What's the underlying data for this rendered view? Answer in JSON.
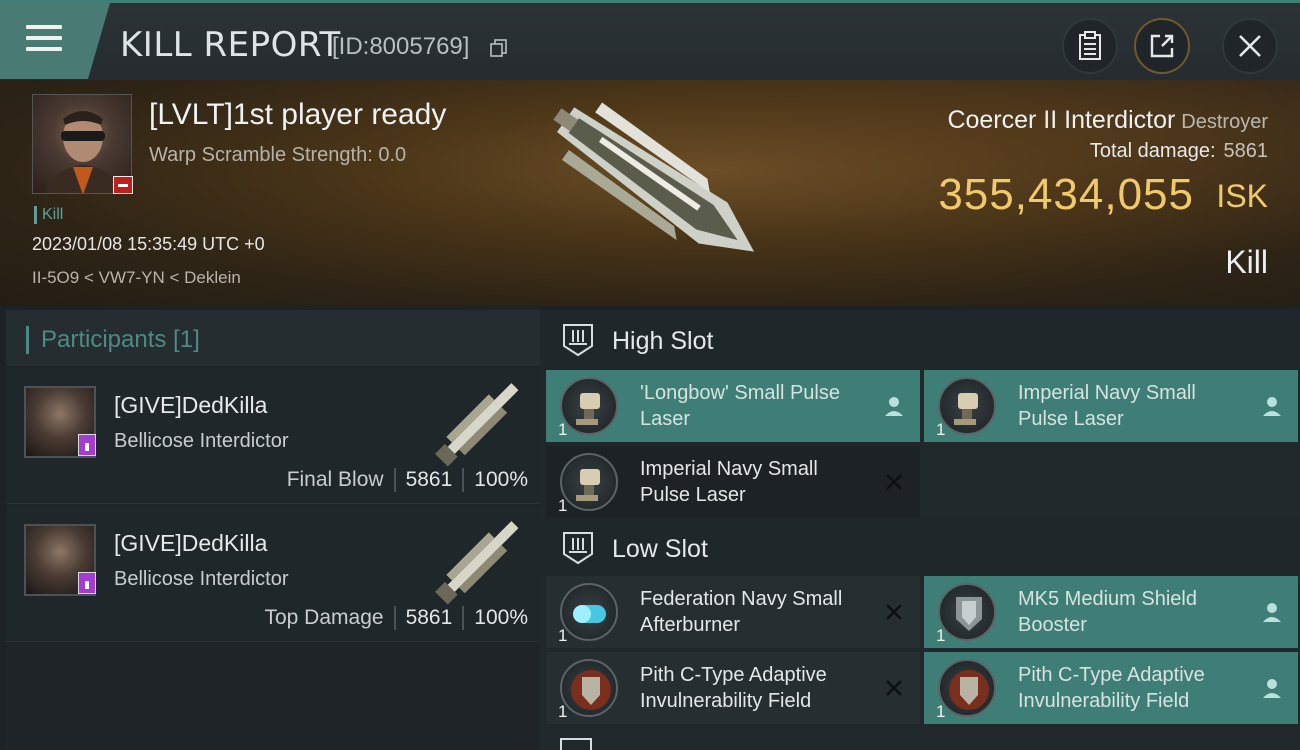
{
  "header": {
    "title": "KILL REPORT",
    "id_label": "[ID:8005769]"
  },
  "victim": {
    "name": "[LVLT]1st player ready",
    "warp": "Warp Scramble Strength: 0.0",
    "kill_tag": "Kill",
    "datetime": "2023/01/08 15:35:49 UTC +0",
    "location": "II-5O9 < VW7-YN < Deklein",
    "ship_name": "Coercer II Interdictor",
    "ship_class": "Destroyer",
    "total_damage_label": "Total damage:",
    "total_damage": "5861",
    "isk_value": "355,434,055",
    "isk_unit": "ISK",
    "result": "Kill"
  },
  "participants": {
    "title": "Participants [1]",
    "rows": [
      {
        "name": "[GIVE]DedKilla",
        "ship": "Bellicose Interdictor",
        "label": "Final Blow",
        "damage": "5861",
        "percent": "100%"
      },
      {
        "name": "[GIVE]DedKilla",
        "ship": "Bellicose Interdictor",
        "label": "Top Damage",
        "damage": "5861",
        "percent": "100%"
      }
    ]
  },
  "fitting": {
    "high_slot": "High Slot",
    "low_slot": "Low Slot",
    "high_modules": [
      {
        "name": "'Longbow' Small Pulse Laser",
        "qty": "1",
        "status": "dropped"
      },
      {
        "name": "Imperial Navy Small Pulse Laser",
        "qty": "1",
        "status": "dropped"
      },
      {
        "name": "Imperial Navy Small Pulse Laser",
        "qty": "1",
        "status": "destroyed"
      }
    ],
    "low_modules": [
      {
        "name": "Federation Navy Small Afterburner",
        "qty": "1",
        "status": "destroyed"
      },
      {
        "name": "MK5 Medium Shield Booster",
        "qty": "1",
        "status": "dropped"
      },
      {
        "name": "Pith C-Type Adaptive Invulnerability Field",
        "qty": "1",
        "status": "destroyed"
      },
      {
        "name": "Pith C-Type Adaptive Invulnerability Field",
        "qty": "1",
        "status": "dropped"
      }
    ]
  },
  "colors": {
    "accent": "#3f7e76",
    "isk": "#f0c96a",
    "victim_badge": "#c0201b",
    "corp_badge": "#a23cd3"
  }
}
